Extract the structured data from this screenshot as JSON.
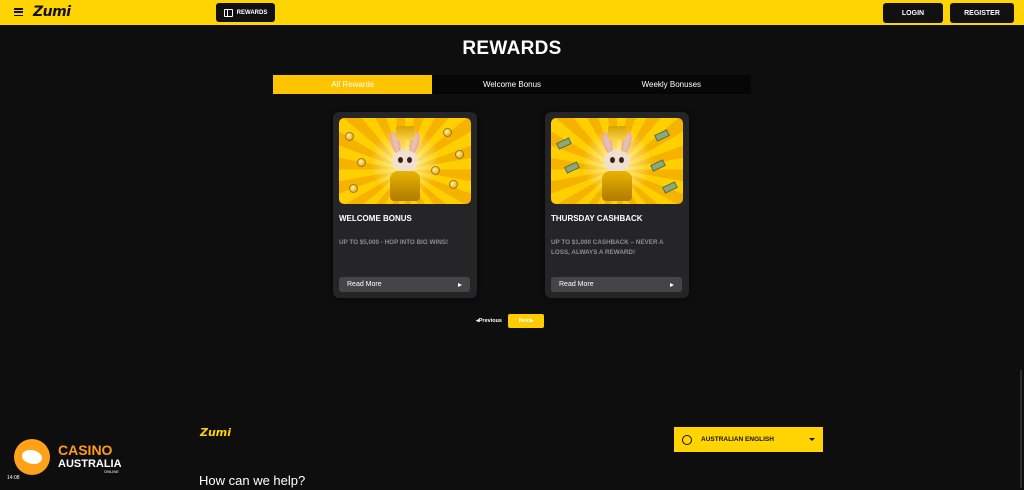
{
  "header": {
    "logo_text": "Zumi",
    "rewards_label": "REWARDS",
    "login_label": "LOGIN",
    "register_label": "REGISTER"
  },
  "page": {
    "title": "REWARDS"
  },
  "tabs": [
    {
      "label": "All Rewards",
      "active": true
    },
    {
      "label": "Welcome Bonus",
      "active": false
    },
    {
      "label": "Weekly Bonuses",
      "active": false
    }
  ],
  "cards": [
    {
      "title": "WELCOME BONUS",
      "description": "UP TO $5,000 - HOP INTO BIG WINS!",
      "button": "Read More",
      "image_icon": "bunny-with-coins-image"
    },
    {
      "title": "THURSDAY CASHBACK",
      "description": "UP TO $1,000 CASHBACK – NEVER A LOSS, ALWAYS A REWARD!",
      "button": "Read More",
      "image_icon": "bunny-with-cash-image"
    }
  ],
  "pagination": {
    "prev_label": "◂Previous",
    "next_label": "Next▸"
  },
  "footer": {
    "logo_text": "Zumi",
    "language": "AUSTRALIAN ENGLISH",
    "help_heading": "How can we help?"
  },
  "watermark": {
    "line1": "CASINO",
    "line2": "AUSTRALIA",
    "line3": "ONLINE",
    "time": "14:08"
  },
  "colors": {
    "accent": "#ffd400",
    "background": "#0e0e0f",
    "card": "#252527"
  }
}
